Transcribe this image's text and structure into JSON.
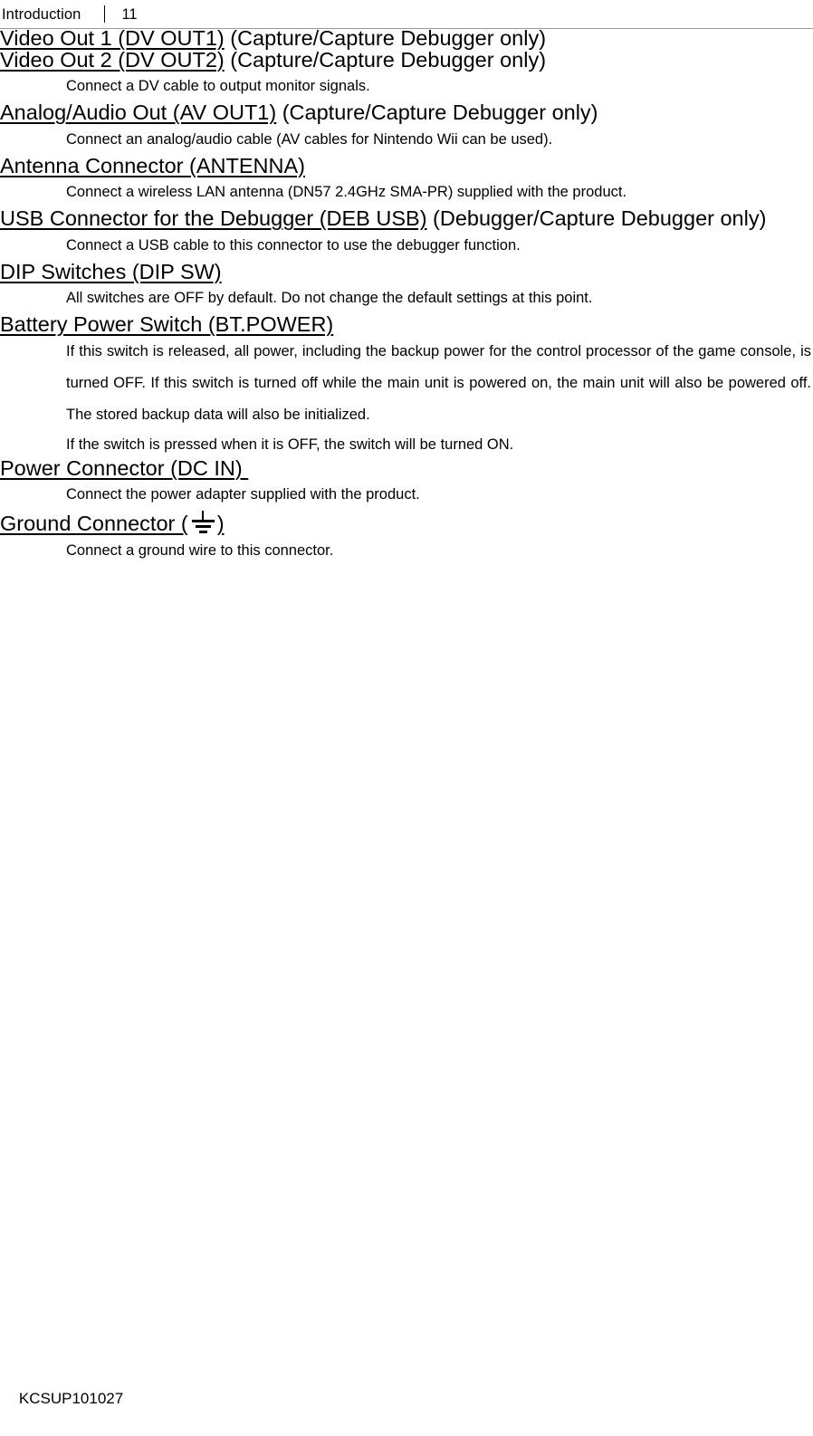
{
  "header": {
    "title": "Introduction",
    "separator": "|",
    "page_number": "11"
  },
  "sections": [
    {
      "heading_underlined": "Video Out 1 (DV OUT1)",
      "heading_plain": " (Capture/Capture Debugger only)",
      "body": []
    },
    {
      "heading_underlined": "Video Out 2 (DV OUT2)",
      "heading_plain": " (Capture/Capture Debugger only)",
      "body": [
        "Connect a DV cable to output monitor signals."
      ]
    },
    {
      "heading_underlined": "Analog/Audio Out (AV OUT1)",
      "heading_plain": " (Capture/Capture Debugger only)",
      "body": [
        "Connect an analog/audio cable (AV cables for Nintendo Wii can be used)."
      ]
    },
    {
      "heading_underlined": "Antenna Connector (ANTENNA)",
      "heading_plain": "",
      "body": [
        "Connect a wireless LAN antenna (DN57 2.4GHz SMA-PR) supplied with the product."
      ]
    },
    {
      "heading_underlined": "USB Connector for the Debugger (DEB USB)",
      "heading_plain": " (Debugger/Capture Debugger only)",
      "body": [
        "Connect a USB cable to this connector to use the debugger function."
      ]
    },
    {
      "heading_underlined": "DIP Switches (DIP SW)",
      "heading_plain": "",
      "body": [
        "All switches are OFF by default. Do not change the default settings at this point."
      ]
    },
    {
      "heading_underlined": "Battery Power Switch (BT.POWER)",
      "heading_plain": "",
      "body": [
        "If this switch is released, all power, including the backup power for the control processor of the game console, is turned OFF. If this switch is turned off while the main unit is powered on, the main unit will also be powered off. The stored backup data will also be initialized.",
        "If the switch is pressed when it is OFF, the switch will be turned ON."
      ]
    },
    {
      "heading_underlined": "Power Connector (DC IN) ",
      "heading_plain": "",
      "body": [
        "Connect the power adapter supplied with the product."
      ]
    },
    {
      "heading_underlined_pre": "Ground Connector (",
      "heading_symbol": "ground-earth-symbol",
      "heading_underlined_post": ")",
      "heading_plain": "",
      "body": [
        "Connect a ground wire to this connector."
      ]
    }
  ],
  "footer": {
    "document_code": "KCSUP101027"
  }
}
